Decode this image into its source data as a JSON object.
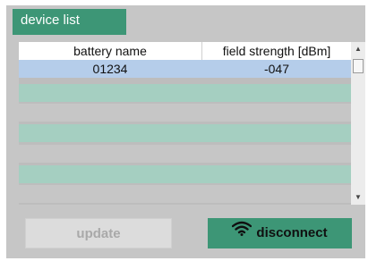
{
  "tab": {
    "label": "device list"
  },
  "table": {
    "columns": [
      "battery name",
      "field strength [dBm]"
    ],
    "rows": [
      {
        "battery_name": "01234",
        "field_strength": "-047",
        "selected": true
      }
    ],
    "empty_rows": 6
  },
  "scrollbar": {
    "up_icon": "arrow-up-icon",
    "down_icon": "arrow-down-icon"
  },
  "buttons": {
    "update_label": "update",
    "disconnect_label": "disconnect",
    "disconnect_icon": "wifi-icon"
  },
  "colors": {
    "accent": "#3d9676",
    "row_selected": "#b5cdea",
    "row_teal": "#a5cfc1",
    "panel": "#c6c6c6",
    "button_disabled": "#dcdcdc"
  }
}
